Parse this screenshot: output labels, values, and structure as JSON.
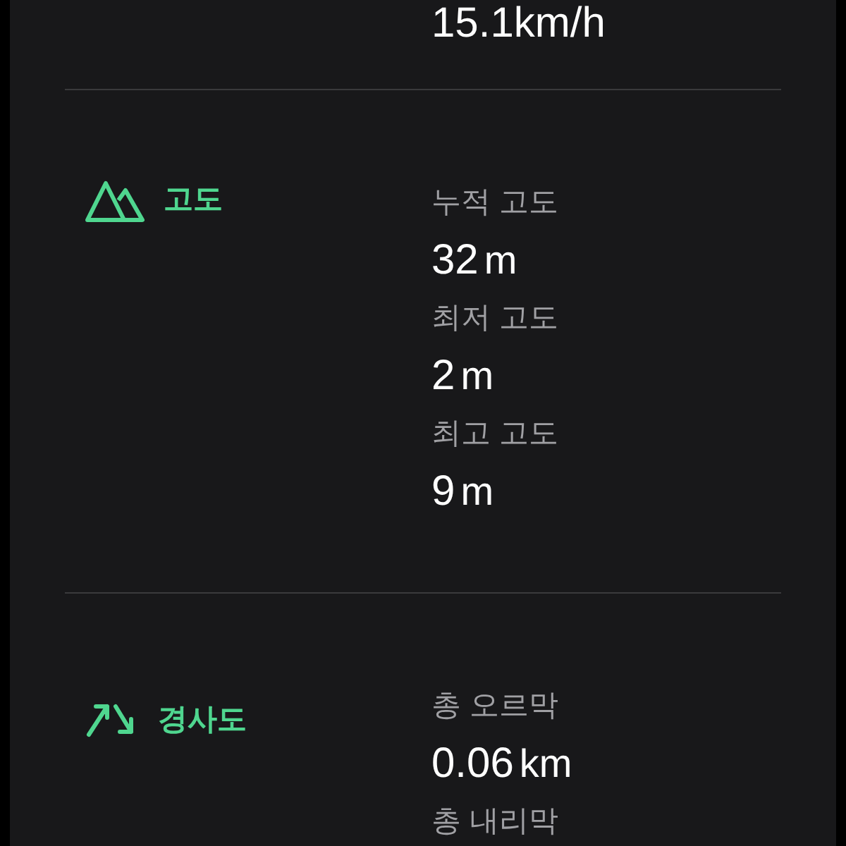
{
  "top_value": "15.1km/h",
  "sections": [
    {
      "kind": "altitude",
      "title": "고도",
      "stats": [
        {
          "label": "누적 고도",
          "value": "32",
          "unit": "m"
        },
        {
          "label": "최저 고도",
          "value": "2",
          "unit": "m"
        },
        {
          "label": "최고 고도",
          "value": "9",
          "unit": "m"
        }
      ]
    },
    {
      "kind": "slope",
      "title": "경사도",
      "stats": [
        {
          "label": "총 오르막",
          "value": "0.06",
          "unit": "km"
        },
        {
          "label": "총 내리막"
        }
      ]
    }
  ]
}
